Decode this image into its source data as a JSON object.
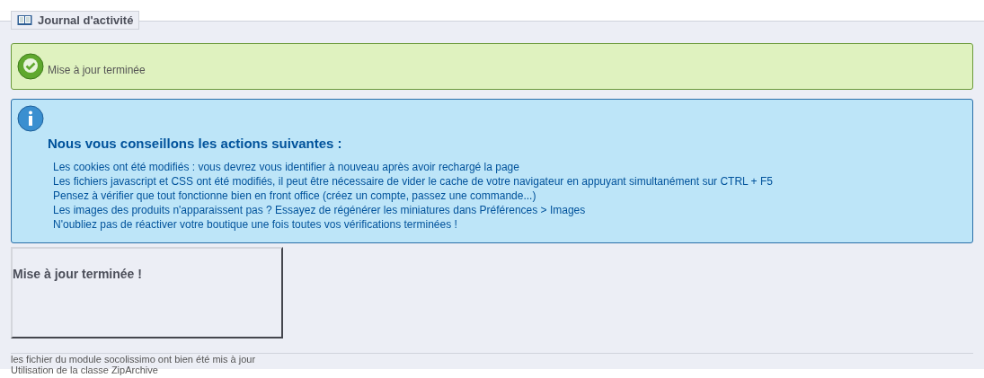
{
  "panel": {
    "legend": "Journal d'activité"
  },
  "success": {
    "message": "Mise à jour terminée"
  },
  "info": {
    "title": "Nous vous conseillons les actions suivantes :",
    "items": [
      "Les cookies ont été modifiés : vous devrez vous identifier à nouveau après avoir rechargé la page",
      "Les fichiers javascript et CSS ont été modifiés, il peut être nécessaire de vider le cache de votre navigateur en appuyant simultanément sur CTRL + F5",
      "Pensez à vérifier que tout fonctionne bien en front office (créez un compte, passez une commande...)",
      "Les images des produits n'apparaissent pas ? Essayez de régénérer les miniatures dans Préférences > Images",
      "N'oubliez pas de réactiver votre boutique une fois toutes vos vérifications terminées !"
    ]
  },
  "result_box": {
    "title": "Mise à jour terminée !"
  },
  "log": [
    "les fichier du module socolissimo ont bien été mis à jour",
    "Utilisation de la classe ZipArchive"
  ]
}
